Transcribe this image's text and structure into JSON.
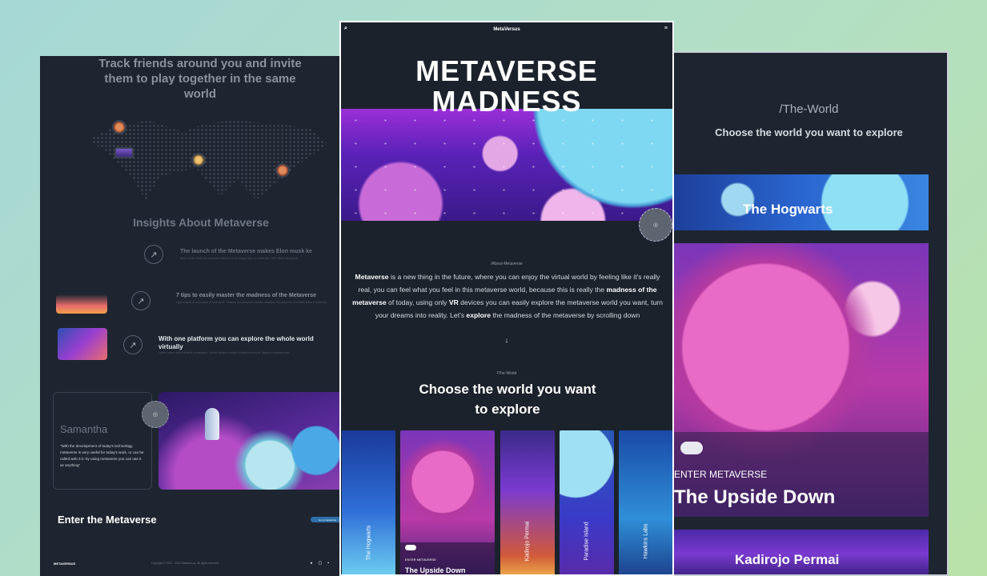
{
  "left": {
    "heading": "Track friends around you and invite them to play together in the same world",
    "insights_title": "Insights About Metaverse",
    "items": [
      {
        "title": "The launch of the Metaverse makes Elon musk ke",
        "sub": "Amet minim mollit non deserunt ullamco est sit aliqua dolor do amet sint. Velit officia consequat."
      },
      {
        "title": "7 tips to easily master the madness of the Metaverse",
        "sub": "Eget magna sit accumsan et felis amet. Tristique dis parturient montes nascetur ridiculus mus. Convallis tellus id interdum."
      },
      {
        "title": "With one platform you can explore the whole world virtually",
        "sub": "Lorem ipsum dolor sit amet consectetur. Viverra facilisis suscipit id amet tempor et. Mauris in aliquam sem."
      }
    ],
    "testimonial_name": "Samantha",
    "testimonial_quote": "\"With the development of today's technology, metaverse is very useful for today's work, or can be called web 3.0. by using metaverse you can use it as anything\"",
    "cta_title": "Enter the Metaverse",
    "cta_button": "Go to metaverse",
    "footer_logo": "METAVERSUS",
    "footer_copy": "Copyright © 2021 - 2022 Metaversus. All rights reserved."
  },
  "center": {
    "brand": "MetaVersus",
    "hero_line1": "METAVERSE",
    "hero_line2": "MADNESS",
    "about_label": "/About-Metaverse",
    "about_body_1": "Metaverse",
    "about_body_2": " is a new thing in the future, where you can enjoy the virtual world by feeling like it's really real, you can feel what you feel in this metaverse world, because this is really the ",
    "about_body_3": "madness of the metaverse",
    "about_body_4": " of today, using only ",
    "about_body_5": "VR",
    "about_body_6": " devices you can easily explore the metaverse world you want, turn your dreams into reality. Let's ",
    "about_body_7": "explore",
    "about_body_8": " the madness of the metaverse by scrolling down",
    "down_arrow": "↓",
    "world_label": "/The-World",
    "world_heading_1": "Choose the world you want",
    "world_heading_2": "to explore",
    "worlds": [
      "The Hogwarts",
      "The Upside Down",
      "Kadirojo Permai",
      "Paradise Island",
      "Hawkins Labs"
    ],
    "active_world_caption": "ENTER METAVERSE",
    "active_world_title": "The Upside Down"
  },
  "right": {
    "label": "/The-World",
    "heading": "Choose the world you want to explore",
    "card1": "The Hogwarts",
    "card2_caption": "ENTER METAVERSE",
    "card2_title": "The Upside Down",
    "card3": "Kadirojo Permai"
  }
}
